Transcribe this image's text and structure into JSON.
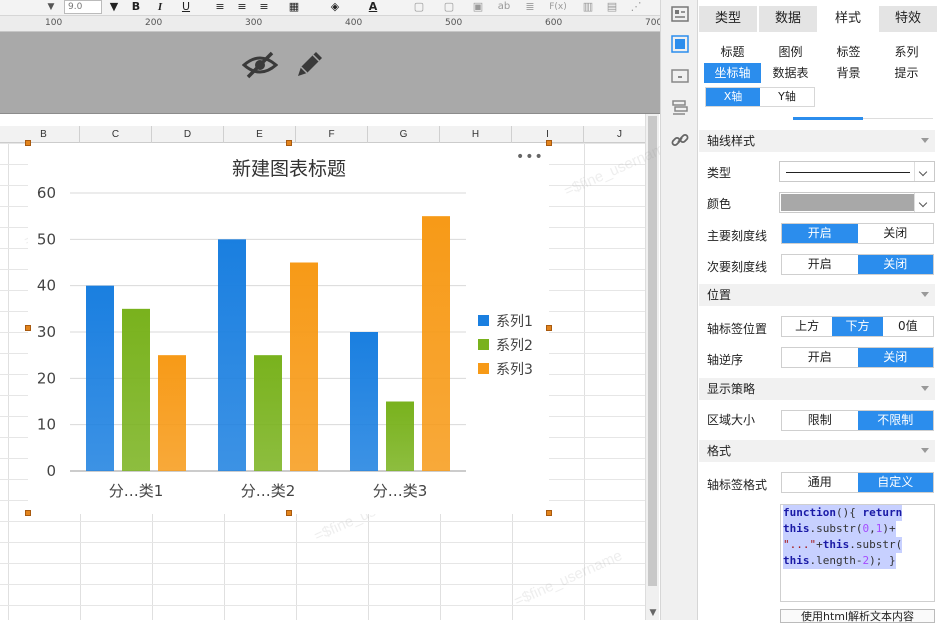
{
  "toolbar": {
    "font_size": "9.0",
    "bold": "B",
    "italic": "I",
    "underline": "U",
    "font_color_label": "A",
    "abc_label": "ab",
    "formula_label": "F(x)"
  },
  "ruler": {
    "labels": [
      "100",
      "200",
      "300",
      "400",
      "500",
      "600",
      "700"
    ]
  },
  "sheet": {
    "columns": [
      "B",
      "C",
      "D",
      "E",
      "F",
      "G",
      "H",
      "I",
      "J"
    ]
  },
  "watermark": "=$fine_username",
  "chart_data": {
    "type": "bar",
    "title": "新建图表标题",
    "categories": [
      "分…类1",
      "分…类2",
      "分…类3"
    ],
    "series": [
      {
        "name": "系列1",
        "values": [
          40,
          50,
          30
        ],
        "color": "#1a7fe0"
      },
      {
        "name": "系列2",
        "values": [
          35,
          25,
          15
        ],
        "color": "#79b21d"
      },
      {
        "name": "系列3",
        "values": [
          25,
          45,
          55
        ],
        "color": "#f79a17"
      }
    ],
    "ylim": [
      0,
      60
    ],
    "yticks": [
      "0",
      "10",
      "20",
      "30",
      "40",
      "50",
      "60"
    ],
    "grid": true,
    "legend": "right"
  },
  "panel": {
    "main_tabs": [
      "类型",
      "数据",
      "样式",
      "特效"
    ],
    "sub_tabs": [
      "标题",
      "图例",
      "标签",
      "系列",
      "坐标轴",
      "数据表",
      "背景",
      "提示"
    ],
    "axis_tabs": [
      "X轴",
      "Y轴"
    ],
    "sections": {
      "axis_style": "轴线样式",
      "position": "位置",
      "display": "显示策略",
      "format": "格式"
    },
    "rows": {
      "type": "类型",
      "color": "颜色",
      "major_tick": "主要刻度线",
      "minor_tick": "次要刻度线",
      "label_pos": "轴标签位置",
      "reverse": "轴逆序",
      "area_size": "区域大小",
      "label_format": "轴标签格式"
    },
    "options": {
      "on": "开启",
      "off": "关闭",
      "top": "上方",
      "bottom": "下方",
      "zero": "0值",
      "limit": "限制",
      "no_limit": "不限制",
      "general": "通用",
      "custom": "自定义"
    },
    "axis_color": "#a8a8a8",
    "code": {
      "l1a": "function",
      "l1b": "(){ ",
      "l1c": "return",
      "l2a": "this",
      "l2b": ".substr(",
      "l2c": "0",
      "l2d": ",",
      "l2e": "1",
      "l2f": ")+",
      "l3a": "\"...\"",
      "l3b": "+",
      "l3c": "this",
      "l3d": ".substr(",
      "l4a": "this",
      "l4b": ".length-",
      "l4c": "2",
      "l4d": "); }"
    },
    "html_button": "使用html解析文本内容"
  }
}
